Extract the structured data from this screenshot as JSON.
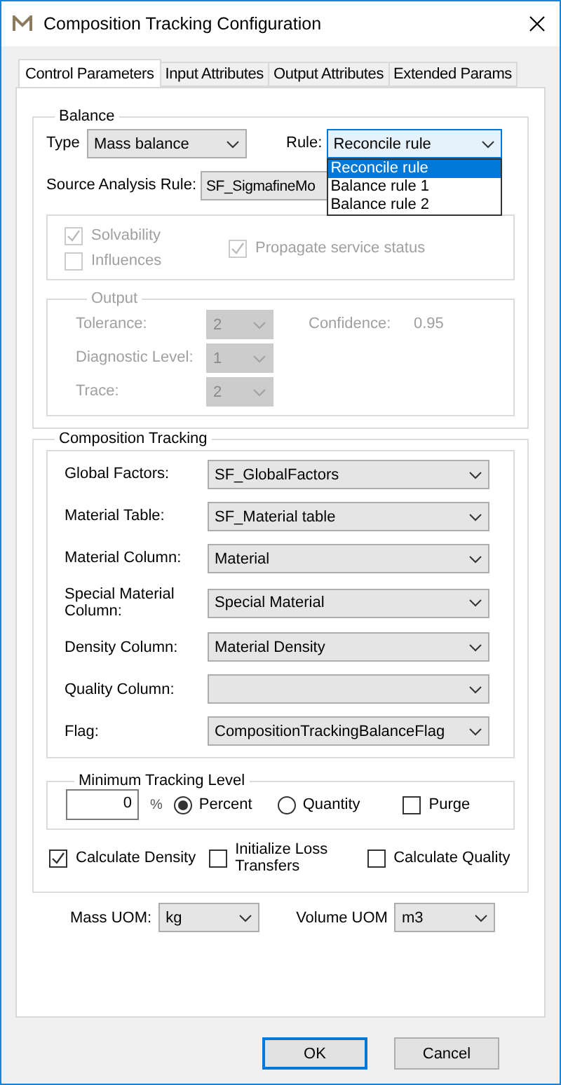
{
  "window": {
    "title": "Composition Tracking Configuration"
  },
  "tabs": [
    {
      "label": "Control Parameters",
      "selected": true
    },
    {
      "label": "Input Attributes",
      "selected": false
    },
    {
      "label": "Output Attributes",
      "selected": false
    },
    {
      "label": "Extended Params",
      "selected": false
    }
  ],
  "balance": {
    "title": "Balance",
    "type_label": "Type",
    "type_value": "Mass balance",
    "rule_label": "Rule:",
    "rule_value": "Reconcile rule",
    "rule_options": [
      {
        "label": "Reconcile rule",
        "selected": true
      },
      {
        "label": "Balance rule 1",
        "selected": false
      },
      {
        "label": "Balance rule 2",
        "selected": false
      }
    ],
    "source_label": "Source Analysis Rule:",
    "source_value": "SF_SigmafineMo",
    "checks": [
      {
        "label": "Solvability",
        "checked": true,
        "disabled": true
      },
      {
        "label": "Influences",
        "checked": false,
        "disabled": true
      },
      {
        "label": "Propagate service status",
        "checked": true,
        "disabled": true
      }
    ]
  },
  "output": {
    "title": "Output",
    "disabled": true,
    "fields": [
      {
        "label": "Tolerance:",
        "value": "2"
      },
      {
        "label": "Diagnostic Level:",
        "value": "1"
      },
      {
        "label": "Trace:",
        "value": "2"
      }
    ],
    "confidence_label": "Confidence:",
    "confidence_value": "0.95"
  },
  "composition": {
    "title": "Composition Tracking",
    "fields": [
      {
        "label": "Global Factors:",
        "value": "SF_GlobalFactors"
      },
      {
        "label": "Material Table:",
        "value": "SF_Material table"
      },
      {
        "label": "Material Column:",
        "value": "Material"
      },
      {
        "label": "Special Material Column:",
        "value": "Special Material"
      },
      {
        "label": "Density Column:",
        "value": "Material Density"
      },
      {
        "label": "Quality Column:"
      },
      {
        "label": "Flag:",
        "value": "CompositionTrackingBalanceFlag"
      }
    ]
  },
  "minimum_tracking": {
    "title": "Minimum Tracking Level",
    "value": "0",
    "unit": "%",
    "modes": [
      {
        "label": "Percent",
        "selected": true
      },
      {
        "label": "Quantity",
        "selected": false
      }
    ],
    "purge": {
      "label": "Purge",
      "checked": false
    }
  },
  "calculations": [
    {
      "label": "Calculate Density",
      "checked": true
    },
    {
      "label": "Initialize Loss Transfers",
      "checked": false
    },
    {
      "label": "Calculate Quality",
      "checked": false
    }
  ],
  "uom": [
    {
      "label": "Mass UOM:",
      "value": "kg"
    },
    {
      "label": "Volume UOM",
      "value": "m3"
    }
  ],
  "buttons": [
    {
      "label": "OK",
      "default": true
    },
    {
      "label": "Cancel",
      "default": false
    }
  ]
}
